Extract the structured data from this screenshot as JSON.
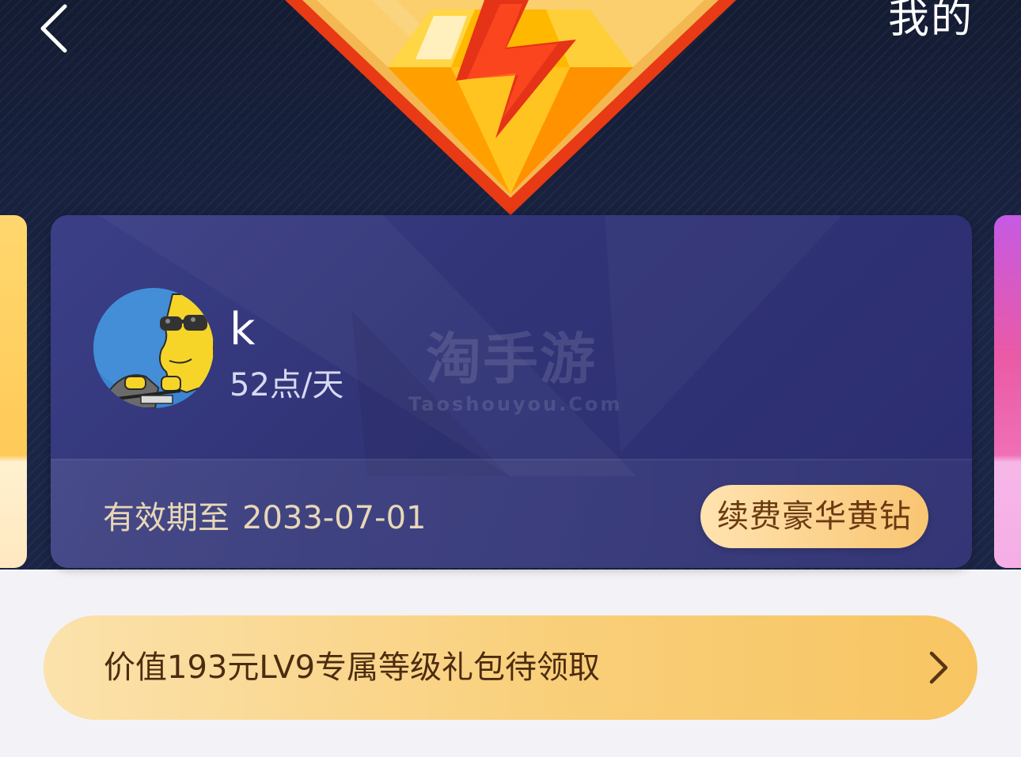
{
  "header": {
    "back_icon": "chevron-left-icon",
    "mine_label": "我的",
    "emblem_icon": "lightning-diamond-icon"
  },
  "member_card": {
    "avatar_icon": "cartoon-avatar-icon",
    "user_name": "k",
    "daily_points": "52点/天",
    "watermark_cn": "淘手游",
    "watermark_en": "Taoshouyou.Com",
    "expiry_label": "有效期至",
    "expiry_date": "2033-07-01",
    "renew_button_label": "续费豪华黄钻"
  },
  "gift_banner": {
    "text": "价值193元LV9专属等级礼包待领取",
    "arrow_icon": "chevron-right-icon"
  },
  "colors": {
    "hero_bg": "#1a2444",
    "card_bg": "#313477",
    "gold_accent": "#f9c572",
    "banner_text": "#4c2c10"
  }
}
